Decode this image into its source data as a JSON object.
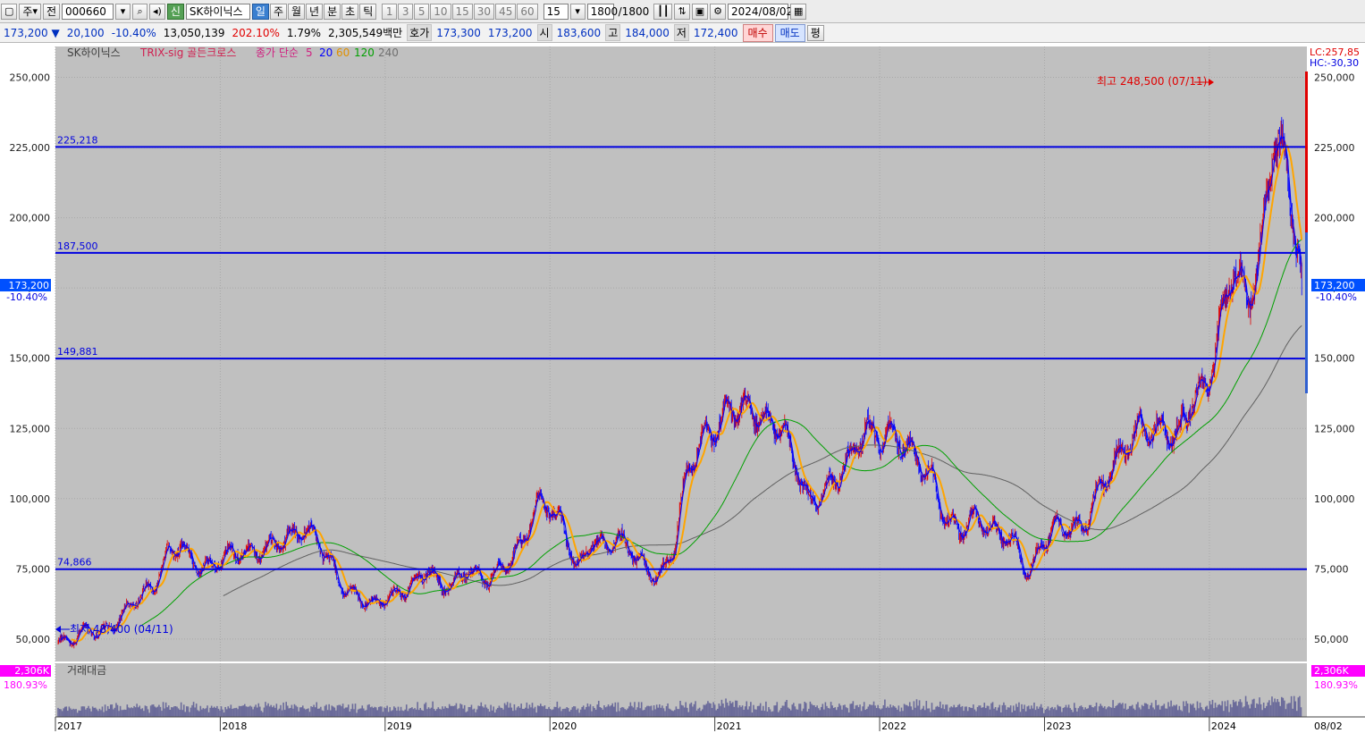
{
  "toolbar": {
    "market_label": "주",
    "prefix_label": "전",
    "code": "000660",
    "search_icon": "magnifier-icon",
    "speaker_icon": "speaker-icon",
    "credit_badge": "신",
    "stock_name": "SK하이닉스",
    "periods": [
      "일",
      "주",
      "월",
      "년",
      "분",
      "초",
      "틱"
    ],
    "active_period": "일",
    "minute_steps": [
      "1",
      "3",
      "5",
      "10",
      "15",
      "30",
      "45",
      "60"
    ],
    "custom_step": "15",
    "count_value": "1800",
    "count_total": "/1800",
    "date": "2024/08/02"
  },
  "quote": {
    "price": "173,200",
    "arrow": "▼",
    "change": "20,100",
    "change_pct": "-10.40%",
    "volume": "13,050,139",
    "volume_ratio": "202.10%",
    "turnover_pct": "1.79%",
    "amount": "2,305,549백만",
    "bid_label": "호가",
    "ask": "173,300",
    "bid": "173,200",
    "open_label": "시",
    "open": "183,600",
    "high_label": "고",
    "high": "184,000",
    "low_label": "저",
    "low": "172,400",
    "buy_label": "매수",
    "sell_label": "매도",
    "eval_label": "평"
  },
  "colors": {
    "plot_bg": "#c0c0c0",
    "up": "#e00000",
    "down": "#0000ff",
    "ma5": "#0000ff",
    "ma20": "#ffa500",
    "ma60": "#00a000",
    "ma120": "#606060",
    "hline": "#0000e0",
    "volume": "#6b6b9a"
  },
  "chart_data": {
    "type": "candlestick",
    "title": "SK하이닉스",
    "indicator": "TRIX-sig 골든크로스",
    "ma_label": "종가 단순",
    "ma_periods": [
      "5",
      "20",
      "60",
      "120",
      "240"
    ],
    "ylim": [
      42000,
      261000
    ],
    "y_ticks": [
      "50,000",
      "75,000",
      "100,000",
      "125,000",
      "150,000",
      "175,000",
      "200,000",
      "225,000",
      "250,000"
    ],
    "y_tick_values": [
      50000,
      75000,
      100000,
      125000,
      150000,
      175000,
      200000,
      225000,
      250000
    ],
    "x_ticks": [
      "2017",
      "2018",
      "2019",
      "2020",
      "2021",
      "2022",
      "2023",
      "2024"
    ],
    "x_tick_dates": [
      "2017-01",
      "2018-01",
      "2019-01",
      "2020-01",
      "2021-01",
      "2022-01",
      "2023-01",
      "2024-01"
    ],
    "x_range": [
      "2017-01",
      "2024-08"
    ],
    "x_end_label": "08/02",
    "lc_label": "LC:257,85",
    "hc_label": "HC:-30,30",
    "last_price_label": "173,200",
    "last_change_label": "-10.40%",
    "max_annotation": {
      "text": "최고 248,500 (07/11)",
      "date": "2024-07",
      "value": 248500
    },
    "min_annotation": {
      "text": "최저 48,400 (04/11)",
      "date": "2017-01",
      "value": 48400
    },
    "hlines": [
      {
        "value": 225218,
        "label": "225,218"
      },
      {
        "value": 187500,
        "label": "187,500"
      },
      {
        "value": 149881,
        "label": "149,881"
      },
      {
        "value": 74866,
        "label": "74,866"
      }
    ],
    "monthly_close": [
      [
        "2017-01",
        49000
      ],
      [
        "2017-02",
        47500
      ],
      [
        "2017-03",
        52000
      ],
      [
        "2017-04",
        52500
      ],
      [
        "2017-05",
        57000
      ],
      [
        "2017-06",
        62000
      ],
      [
        "2017-07",
        64000
      ],
      [
        "2017-08",
        66000
      ],
      [
        "2017-09",
        79000
      ],
      [
        "2017-10",
        86000
      ],
      [
        "2017-11",
        80000
      ],
      [
        "2017-12",
        76000
      ],
      [
        "2018-01",
        76000
      ],
      [
        "2018-02",
        78000
      ],
      [
        "2018-03",
        81000
      ],
      [
        "2018-04",
        85000
      ],
      [
        "2018-05",
        87000
      ],
      [
        "2018-06",
        85000
      ],
      [
        "2018-07",
        86000
      ],
      [
        "2018-08",
        83000
      ],
      [
        "2018-09",
        78000
      ],
      [
        "2018-10",
        70000
      ],
      [
        "2018-11",
        66000
      ],
      [
        "2018-12",
        60000
      ],
      [
        "2019-01",
        62000
      ],
      [
        "2019-02",
        66000
      ],
      [
        "2019-03",
        72000
      ],
      [
        "2019-04",
        78000
      ],
      [
        "2019-05",
        68000
      ],
      [
        "2019-06",
        67000
      ],
      [
        "2019-07",
        73000
      ],
      [
        "2019-08",
        72000
      ],
      [
        "2019-09",
        76000
      ],
      [
        "2019-10",
        80000
      ],
      [
        "2019-11",
        82000
      ],
      [
        "2019-12",
        94000
      ],
      [
        "2020-01",
        96000
      ],
      [
        "2020-02",
        93000
      ],
      [
        "2020-03",
        77000
      ],
      [
        "2020-04",
        85000
      ],
      [
        "2020-05",
        80000
      ],
      [
        "2020-06",
        83000
      ],
      [
        "2020-07",
        82000
      ],
      [
        "2020-08",
        78000
      ],
      [
        "2020-09",
        74000
      ],
      [
        "2020-10",
        80000
      ],
      [
        "2020-11",
        104000
      ],
      [
        "2020-12",
        118000
      ],
      [
        "2021-01",
        128000
      ],
      [
        "2021-02",
        137000
      ],
      [
        "2021-03",
        134000
      ],
      [
        "2021-04",
        126000
      ],
      [
        "2021-05",
        122000
      ],
      [
        "2021-06",
        125000
      ],
      [
        "2021-07",
        117000
      ],
      [
        "2021-08",
        101000
      ],
      [
        "2021-09",
        101000
      ],
      [
        "2021-10",
        103000
      ],
      [
        "2021-11",
        111000
      ],
      [
        "2021-12",
        128000
      ],
      [
        "2022-01",
        127000
      ],
      [
        "2022-02",
        125000
      ],
      [
        "2022-03",
        115000
      ],
      [
        "2022-04",
        109000
      ],
      [
        "2022-05",
        106000
      ],
      [
        "2022-06",
        95000
      ],
      [
        "2022-07",
        92000
      ],
      [
        "2022-08",
        93000
      ],
      [
        "2022-09",
        86000
      ],
      [
        "2022-10",
        85000
      ],
      [
        "2022-11",
        85000
      ],
      [
        "2022-12",
        76000
      ],
      [
        "2023-01",
        86000
      ],
      [
        "2023-02",
        88000
      ],
      [
        "2023-03",
        86000
      ],
      [
        "2023-04",
        88000
      ],
      [
        "2023-05",
        105000
      ],
      [
        "2023-06",
        115000
      ],
      [
        "2023-07",
        118000
      ],
      [
        "2023-08",
        121000
      ],
      [
        "2023-09",
        120000
      ],
      [
        "2023-10",
        125000
      ],
      [
        "2023-11",
        128000
      ],
      [
        "2023-12",
        140000
      ],
      [
        "2024-01",
        136000
      ],
      [
        "2024-02",
        155000
      ],
      [
        "2024-03",
        180000
      ],
      [
        "2024-04",
        175000
      ],
      [
        "2024-05",
        195000
      ],
      [
        "2024-06",
        235000
      ],
      [
        "2024-07",
        205000
      ],
      [
        "2024-08",
        173200
      ]
    ],
    "volume_label": "거래대금",
    "volume_max_label": "2,306K",
    "volume_pct_label": "180.93%"
  }
}
